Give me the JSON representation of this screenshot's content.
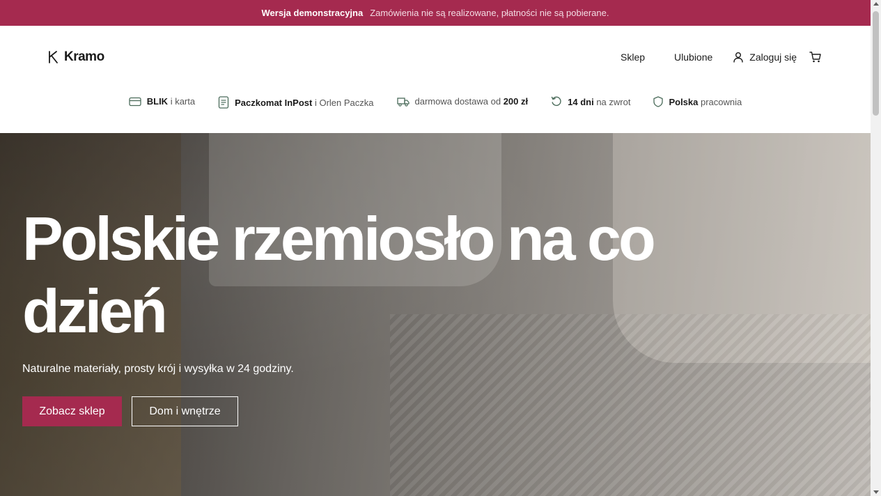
{
  "demo_banner": {
    "strong": "Wersja demonstracyjna",
    "text": "Zamówienia nie są realizowane, płatności nie są pobierane.",
    "color": "#a52a4f"
  },
  "header": {
    "logo_text": "Kramo",
    "nav": {
      "shop": "Sklep",
      "favorites": "Ulubione",
      "login": "Zaloguj się"
    }
  },
  "features": [
    {
      "icon": "card-icon",
      "strong": "BLIK",
      "text": " i karta"
    },
    {
      "icon": "document-icon",
      "strong": "Paczkomat InPost",
      "text": " i Orlen Paczka"
    },
    {
      "icon": "truck-icon",
      "pre": "darmowa dostawa od ",
      "strong": "200 zł"
    },
    {
      "icon": "return-icon",
      "strong": "14 dni",
      "text": " na zwrot"
    },
    {
      "icon": "shield-icon",
      "strong": "Polska",
      "text": " pracownia"
    }
  ],
  "hero": {
    "title": "Polskie rzemiosło na co dzień",
    "subtitle": "Naturalne materiały, prosty krój i wysyłka w 24 godziny.",
    "primary_button": "Zobacz sklep",
    "secondary_button": "Dom i wnętrze"
  },
  "colors": {
    "accent": "#a52a4f",
    "text": "#1a1a1a",
    "muted": "#555555"
  }
}
